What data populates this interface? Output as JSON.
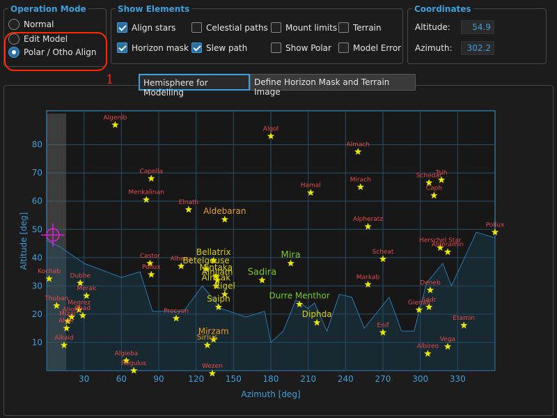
{
  "operation_mode": {
    "title": "Operation Mode",
    "options": [
      {
        "label": "Normal",
        "selected": false
      },
      {
        "label": "Edit Model",
        "selected": false
      },
      {
        "label": "Polar / Otho Align",
        "selected": true
      }
    ],
    "annotation": "1"
  },
  "show_elements": {
    "title": "Show Elements",
    "items": [
      {
        "label": "Align stars",
        "checked": true
      },
      {
        "label": "Celestial paths",
        "checked": false
      },
      {
        "label": "Mount limits",
        "checked": false
      },
      {
        "label": "Terrain",
        "checked": false
      },
      {
        "label": "Horizon mask",
        "checked": true
      },
      {
        "label": "Slew path",
        "checked": true
      },
      {
        "label": "Show Polar",
        "checked": false
      },
      {
        "label": "Model Error",
        "checked": false
      }
    ]
  },
  "coordinates": {
    "title": "Coordinates",
    "altitude_label": "Altitude:",
    "altitude_value": "54.9",
    "azimuth_label": "Azimuth:",
    "azimuth_value": "302.2"
  },
  "tabs": [
    {
      "label": "Hemisphere for Modelling",
      "active": true
    },
    {
      "label": "Define Horizon Mask and Terrain Image",
      "active": false
    }
  ],
  "colors": {
    "accent": "#3ea0dc",
    "star": "#e8e800",
    "star_label_red": "#e84a4a",
    "star_label_orange": "#e8a020",
    "star_label_yellow": "#d8d000",
    "star_label_green": "#7ac81e",
    "annotation": "#ff2a00",
    "polar_marker": "#e020e0"
  },
  "chart_data": {
    "type": "scatter",
    "title": "",
    "xlabel": "Azimuth [deg]",
    "ylabel": "Altitude [deg]",
    "xlim": [
      0,
      360
    ],
    "ylim": [
      0,
      92
    ],
    "xticks": [
      30,
      60,
      90,
      120,
      150,
      180,
      210,
      240,
      270,
      300,
      330
    ],
    "yticks": [
      10,
      20,
      30,
      40,
      50,
      60,
      70,
      80
    ],
    "grid": true,
    "polar_marker": {
      "az": 5,
      "alt": 48
    },
    "horizon_mask": [
      [
        0,
        46
      ],
      [
        10,
        44
      ],
      [
        30,
        38
      ],
      [
        60,
        33
      ],
      [
        75,
        35
      ],
      [
        85,
        21
      ],
      [
        110,
        21
      ],
      [
        125,
        30
      ],
      [
        140,
        22
      ],
      [
        160,
        19
      ],
      [
        175,
        21
      ],
      [
        180,
        10
      ],
      [
        190,
        14
      ],
      [
        200,
        25
      ],
      [
        210,
        22
      ],
      [
        215,
        24
      ],
      [
        225,
        14
      ],
      [
        235,
        27
      ],
      [
        245,
        26
      ],
      [
        255,
        15
      ],
      [
        275,
        26
      ],
      [
        285,
        14
      ],
      [
        295,
        14
      ],
      [
        305,
        31
      ],
      [
        318,
        38
      ],
      [
        325,
        30
      ],
      [
        345,
        49
      ],
      [
        360,
        47
      ]
    ],
    "stars": [
      {
        "name": "Algenib",
        "az": 55,
        "alt": 87,
        "c": "red",
        "s": 9
      },
      {
        "name": "Algol",
        "az": 180,
        "alt": 83,
        "c": "red",
        "s": 9
      },
      {
        "name": "Almach",
        "az": 250,
        "alt": 77.5,
        "c": "red",
        "s": 9
      },
      {
        "name": "Capella",
        "az": 84,
        "alt": 68,
        "c": "red",
        "s": 9
      },
      {
        "name": "Mirach",
        "az": 252,
        "alt": 65,
        "c": "red",
        "s": 9
      },
      {
        "name": "Schedar",
        "az": 307,
        "alt": 66.5,
        "c": "red",
        "s": 9
      },
      {
        "name": "Tsih",
        "az": 317,
        "alt": 67.5,
        "c": "red",
        "s": 9
      },
      {
        "name": "Caph",
        "az": 311,
        "alt": 62,
        "c": "red",
        "s": 9
      },
      {
        "name": "Hamal",
        "az": 212,
        "alt": 63,
        "c": "red",
        "s": 9
      },
      {
        "name": "Menkalinan",
        "az": 80,
        "alt": 60.5,
        "c": "red",
        "s": 9
      },
      {
        "name": "Elnath",
        "az": 114,
        "alt": 57,
        "c": "red",
        "s": 9
      },
      {
        "name": "Aldebaran",
        "az": 143,
        "alt": 53.5,
        "c": "orange",
        "s": 12
      },
      {
        "name": "Alpheratz",
        "az": 258,
        "alt": 51,
        "c": "red",
        "s": 9
      },
      {
        "name": "Pollux",
        "az": 360,
        "alt": 49,
        "c": "red",
        "s": 9
      },
      {
        "name": "Herschel Star",
        "az": 316,
        "alt": 43.5,
        "c": "red",
        "s": 9
      },
      {
        "name": "Alderamin",
        "az": 322,
        "alt": 42,
        "c": "red",
        "s": 9
      },
      {
        "name": "Castor",
        "az": 83,
        "alt": 38,
        "c": "red",
        "s": 9
      },
      {
        "name": "Pollux",
        "az": 84,
        "alt": 34,
        "c": "red",
        "s": 9
      },
      {
        "name": "Alhena",
        "az": 108,
        "alt": 37,
        "c": "red",
        "s": 9
      },
      {
        "name": "Bellatrix",
        "az": 134,
        "alt": 39,
        "c": "yellow",
        "s": 12
      },
      {
        "name": "Betelgeuse",
        "az": 128,
        "alt": 36,
        "c": "yellow",
        "s": 12
      },
      {
        "name": "Mintaka",
        "az": 136,
        "alt": 33.5,
        "c": "yellow",
        "s": 12
      },
      {
        "name": "Alnilam",
        "az": 137,
        "alt": 32,
        "c": "yellow",
        "s": 12
      },
      {
        "name": "Alnitak",
        "az": 136,
        "alt": 30,
        "c": "yellow",
        "s": 12
      },
      {
        "name": "Rigel",
        "az": 143,
        "alt": 27,
        "c": "yellow",
        "s": 12
      },
      {
        "name": "Saiph",
        "az": 138,
        "alt": 22.5,
        "c": "yellow",
        "s": 12
      },
      {
        "name": "Mira",
        "az": 196,
        "alt": 38,
        "c": "green",
        "s": 13
      },
      {
        "name": "Sadira",
        "az": 173,
        "alt": 32,
        "c": "green",
        "s": 13
      },
      {
        "name": "Scheat",
        "az": 270,
        "alt": 39.5,
        "c": "red",
        "s": 9
      },
      {
        "name": "Markab",
        "az": 258,
        "alt": 30.5,
        "c": "red",
        "s": 9
      },
      {
        "name": "Deneb",
        "az": 308,
        "alt": 28.5,
        "c": "red",
        "s": 9
      },
      {
        "name": "Sadr",
        "az": 307,
        "alt": 22.5,
        "c": "red",
        "s": 9
      },
      {
        "name": "Gienah",
        "az": 299,
        "alt": 21.5,
        "c": "red",
        "s": 9
      },
      {
        "name": "Durre Menthor",
        "az": 203,
        "alt": 23.5,
        "c": "green",
        "s": 12
      },
      {
        "name": "Diphda",
        "az": 217,
        "alt": 17,
        "c": "yellow",
        "s": 12
      },
      {
        "name": "Enif",
        "az": 270,
        "alt": 13.5,
        "c": "red",
        "s": 9
      },
      {
        "name": "Etamin",
        "az": 335,
        "alt": 16,
        "c": "red",
        "s": 9
      },
      {
        "name": "Albireo",
        "az": 306,
        "alt": 6,
        "c": "red",
        "s": 9
      },
      {
        "name": "Vega",
        "az": 322,
        "alt": 8.5,
        "c": "red",
        "s": 9
      },
      {
        "name": "Procyon",
        "az": 104,
        "alt": 18.5,
        "c": "red",
        "s": 9
      },
      {
        "name": "Mirzam",
        "az": 134,
        "alt": 11,
        "c": "orange",
        "s": 12
      },
      {
        "name": "Sirius",
        "az": 129,
        "alt": 9,
        "c": "orange",
        "s": 11
      },
      {
        "name": "Algieba",
        "az": 64,
        "alt": 3.5,
        "c": "red",
        "s": 9
      },
      {
        "name": "Regulus",
        "az": 70,
        "alt": 0,
        "c": "red",
        "s": 9
      },
      {
        "name": "Wezen",
        "az": 133,
        "alt": -1,
        "c": "red",
        "s": 9
      },
      {
        "name": "Kochab",
        "az": 2,
        "alt": 32.5,
        "c": "red",
        "s": 9
      },
      {
        "name": "Dubhe",
        "az": 27,
        "alt": 31,
        "c": "red",
        "s": 9
      },
      {
        "name": "Merak",
        "az": 32,
        "alt": 26.5,
        "c": "red",
        "s": 9
      },
      {
        "name": "Thuban",
        "az": 8,
        "alt": 23,
        "c": "red",
        "s": 9
      },
      {
        "name": "Megrez",
        "az": 26,
        "alt": 21.5,
        "c": "red",
        "s": 9
      },
      {
        "name": "Phad",
        "az": 29,
        "alt": 19.5,
        "c": "red",
        "s": 9
      },
      {
        "name": "Alioth",
        "az": 20,
        "alt": 19,
        "c": "red",
        "s": 9
      },
      {
        "name": "Mizar",
        "az": 17,
        "alt": 17.5,
        "c": "red",
        "s": 9
      },
      {
        "name": "Alcor",
        "az": 16,
        "alt": 15,
        "c": "red",
        "s": 9
      },
      {
        "name": "Alkaid",
        "az": 14,
        "alt": 9,
        "c": "red",
        "s": 9
      }
    ]
  }
}
